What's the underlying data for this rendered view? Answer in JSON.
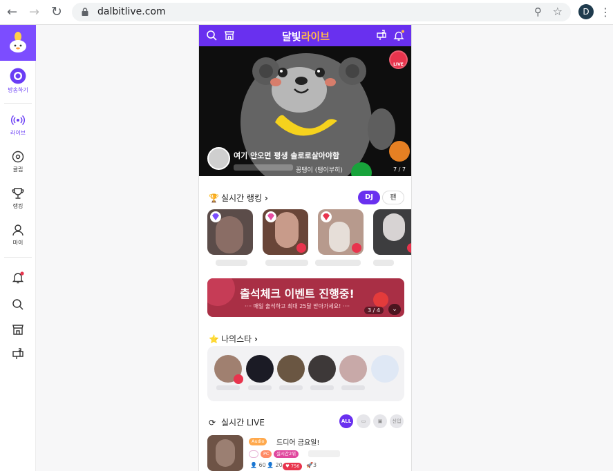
{
  "browser": {
    "url": "dalbitlive.com",
    "profile_initial": "D"
  },
  "sidebar": {
    "broadcast_label": "방송하기",
    "items": [
      {
        "label": "라이브",
        "icon": "live-signal-icon"
      },
      {
        "label": "클립",
        "icon": "clip-disc-icon"
      },
      {
        "label": "랭킹",
        "icon": "trophy-icon"
      },
      {
        "label": "마이",
        "icon": "person-icon"
      }
    ],
    "bottom_icons": [
      "bell-icon",
      "search-icon",
      "store-icon",
      "mailbox-icon"
    ],
    "accent": "#7c4dff"
  },
  "app": {
    "brand_a": "달빛",
    "brand_b": "라이브",
    "header_color": "#6930ef"
  },
  "banner": {
    "title": "여기 안오면 평생 솔로로살아야함",
    "host": "꽁탱이 (탱이부히)",
    "page": "7 / 7",
    "live_badge": "LIVE"
  },
  "ranking": {
    "title": "실시간 랭킹",
    "tab_dj": "DJ",
    "tab_fan": "팬"
  },
  "promo": {
    "title": "출석체크 이벤트 진행중!",
    "subtitle": "···· 매일 출석하고 최대 25달 받아가세요! ····",
    "page": "3 / 4",
    "color": "#a92f45"
  },
  "my_star": {
    "title": "나의스타"
  },
  "live_list": {
    "title": "실시간 LIVE",
    "filters": [
      "ALL",
      "영상",
      "오디오",
      "신입"
    ],
    "first_item": {
      "type_tag": "Audio",
      "title": "드디어 금요일!",
      "tag_pc": "PC",
      "tag_rank": "실시간2위",
      "listeners": "60",
      "fans": "20",
      "likes": "756",
      "boosts": "3"
    }
  }
}
